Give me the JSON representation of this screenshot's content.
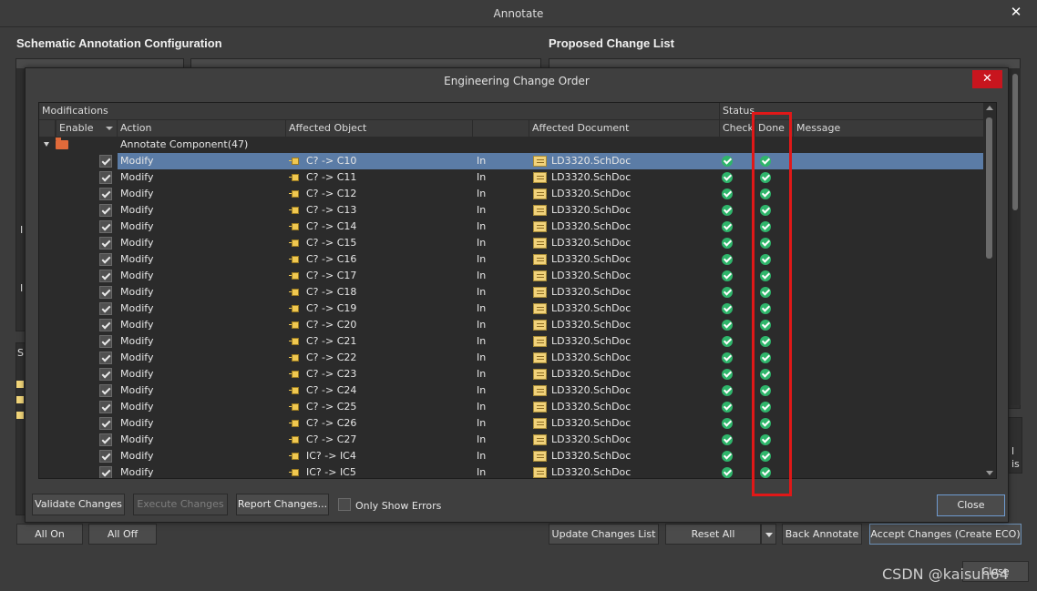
{
  "annotate": {
    "title": "Annotate",
    "close_glyph": "✕",
    "left_heading": "Schematic Annotation Configuration",
    "right_heading": "Proposed Change List",
    "buttons": {
      "all_on": "All On",
      "all_off": "All Off",
      "update_changes_list": "Update Changes List",
      "reset_all": "Reset All",
      "back_annotate": "Back Annotate",
      "accept_changes": "Accept Changes (Create ECO)",
      "close": "Close"
    },
    "left_fragments": [
      "I",
      "I",
      "S"
    ],
    "right_fragments": [
      "l",
      "is"
    ]
  },
  "eco": {
    "title": "Engineering Change Order",
    "close_glyph": "✕",
    "group_headers": {
      "modifications": "Modifications",
      "status": "Status"
    },
    "columns": {
      "enable": "Enable",
      "action": "Action",
      "affected_object": "Affected Object",
      "affected_document": "Affected Document",
      "check": "Check",
      "done": "Done",
      "message": "Message"
    },
    "group_row_label": "Annotate Component(47)",
    "rows": [
      {
        "action": "Modify",
        "object": "C? -> C10",
        "dir": "In",
        "document": "LD3320.SchDoc"
      },
      {
        "action": "Modify",
        "object": "C? -> C11",
        "dir": "In",
        "document": "LD3320.SchDoc"
      },
      {
        "action": "Modify",
        "object": "C? -> C12",
        "dir": "In",
        "document": "LD3320.SchDoc"
      },
      {
        "action": "Modify",
        "object": "C? -> C13",
        "dir": "In",
        "document": "LD3320.SchDoc"
      },
      {
        "action": "Modify",
        "object": "C? -> C14",
        "dir": "In",
        "document": "LD3320.SchDoc"
      },
      {
        "action": "Modify",
        "object": "C? -> C15",
        "dir": "In",
        "document": "LD3320.SchDoc"
      },
      {
        "action": "Modify",
        "object": "C? -> C16",
        "dir": "In",
        "document": "LD3320.SchDoc"
      },
      {
        "action": "Modify",
        "object": "C? -> C17",
        "dir": "In",
        "document": "LD3320.SchDoc"
      },
      {
        "action": "Modify",
        "object": "C? -> C18",
        "dir": "In",
        "document": "LD3320.SchDoc"
      },
      {
        "action": "Modify",
        "object": "C? -> C19",
        "dir": "In",
        "document": "LD3320.SchDoc"
      },
      {
        "action": "Modify",
        "object": "C? -> C20",
        "dir": "In",
        "document": "LD3320.SchDoc"
      },
      {
        "action": "Modify",
        "object": "C? -> C21",
        "dir": "In",
        "document": "LD3320.SchDoc"
      },
      {
        "action": "Modify",
        "object": "C? -> C22",
        "dir": "In",
        "document": "LD3320.SchDoc"
      },
      {
        "action": "Modify",
        "object": "C? -> C23",
        "dir": "In",
        "document": "LD3320.SchDoc"
      },
      {
        "action": "Modify",
        "object": "C? -> C24",
        "dir": "In",
        "document": "LD3320.SchDoc"
      },
      {
        "action": "Modify",
        "object": "C? -> C25",
        "dir": "In",
        "document": "LD3320.SchDoc"
      },
      {
        "action": "Modify",
        "object": "C? -> C26",
        "dir": "In",
        "document": "LD3320.SchDoc"
      },
      {
        "action": "Modify",
        "object": "C? -> C27",
        "dir": "In",
        "document": "LD3320.SchDoc"
      },
      {
        "action": "Modify",
        "object": "IC? -> IC4",
        "dir": "In",
        "document": "LD3320.SchDoc"
      },
      {
        "action": "Modify",
        "object": "IC? -> IC5",
        "dir": "In",
        "document": "LD3320.SchDoc"
      }
    ],
    "selected_row": 0,
    "buttons": {
      "validate": "Validate Changes",
      "execute": "Execute Changes",
      "report": "Report Changes...",
      "only_show_errors": "Only Show Errors",
      "close": "Close"
    }
  },
  "watermark": "CSDN @kaisuh64",
  "colors": {
    "selection": "#5b7ca6",
    "ok_green": "#2fb56b",
    "highlight_box": "#e01818",
    "close_red": "#c8151e"
  }
}
